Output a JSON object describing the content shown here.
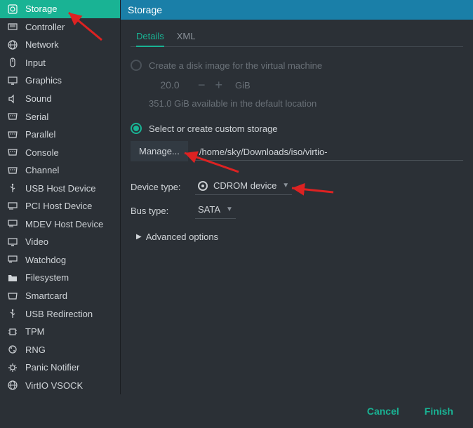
{
  "title": "Storage",
  "tabs": {
    "details": "Details",
    "xml": "XML"
  },
  "sidebar": {
    "items": [
      {
        "label": "Storage"
      },
      {
        "label": "Controller"
      },
      {
        "label": "Network"
      },
      {
        "label": "Input"
      },
      {
        "label": "Graphics"
      },
      {
        "label": "Sound"
      },
      {
        "label": "Serial"
      },
      {
        "label": "Parallel"
      },
      {
        "label": "Console"
      },
      {
        "label": "Channel"
      },
      {
        "label": "USB Host Device"
      },
      {
        "label": "PCI Host Device"
      },
      {
        "label": "MDEV Host Device"
      },
      {
        "label": "Video"
      },
      {
        "label": "Watchdog"
      },
      {
        "label": "Filesystem"
      },
      {
        "label": "Smartcard"
      },
      {
        "label": "USB Redirection"
      },
      {
        "label": "TPM"
      },
      {
        "label": "RNG"
      },
      {
        "label": "Panic Notifier"
      },
      {
        "label": "VirtIO VSOCK"
      }
    ]
  },
  "storage": {
    "opt1_label": "Create a disk image for the virtual machine",
    "size_value": "20.0",
    "size_unit": "GiB",
    "available": "351.0 GiB available in the default location",
    "opt2_label": "Select or create custom storage",
    "manage_btn": "Manage...",
    "path": "/home/sky/Downloads/iso/virtio-",
    "device_type_label": "Device type:",
    "device_type_value": "CDROM device",
    "bus_type_label": "Bus type:",
    "bus_type_value": "SATA",
    "advanced": "Advanced options"
  },
  "footer": {
    "cancel": "Cancel",
    "finish": "Finish"
  }
}
